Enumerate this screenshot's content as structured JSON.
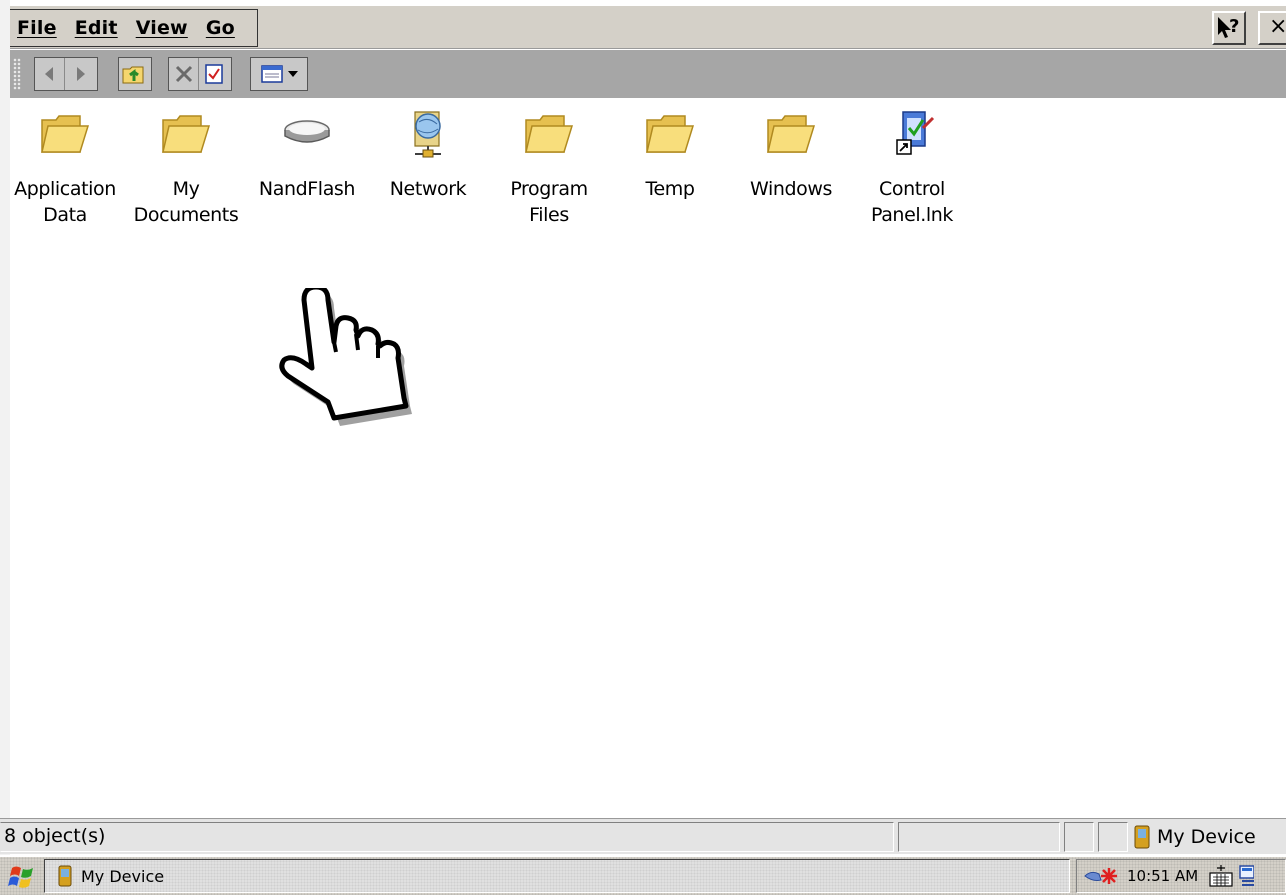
{
  "menu": {
    "file": "File",
    "edit": "Edit",
    "view": "View",
    "go": "Go"
  },
  "title_buttons": {
    "help_icon": "help-pointer-icon",
    "close_label": "×"
  },
  "toolbar": {
    "icons": [
      "back-arrow-icon",
      "forward-arrow-icon",
      "up-folder-icon",
      "delete-icon",
      "properties-icon",
      "view-menu-icon"
    ]
  },
  "files": [
    {
      "label": "Application\nData",
      "icon": "folder-icon"
    },
    {
      "label": "My\nDocuments",
      "icon": "folder-icon"
    },
    {
      "label": "NandFlash",
      "icon": "drive-icon"
    },
    {
      "label": "Network",
      "icon": "network-icon"
    },
    {
      "label": "Program Files",
      "icon": "folder-icon"
    },
    {
      "label": "Temp",
      "icon": "folder-icon"
    },
    {
      "label": "Windows",
      "icon": "folder-icon"
    },
    {
      "label": "Control\nPanel.lnk",
      "icon": "control-panel-shortcut-icon"
    }
  ],
  "status": {
    "count_text": "8 object(s)",
    "location": "My Device"
  },
  "taskbar": {
    "start_icon": "windows-flag-icon",
    "task_label": "My Device",
    "clock": "10:51 AM",
    "tray_icons": [
      "connection-icon",
      "input-panel-keyboard-icon",
      "desktop-icon"
    ]
  },
  "colors": {
    "folder": "#f5d66e",
    "folder_edge": "#b08a20",
    "menubar": "#d4d0c8",
    "toolbar": "#a6a6a6"
  }
}
